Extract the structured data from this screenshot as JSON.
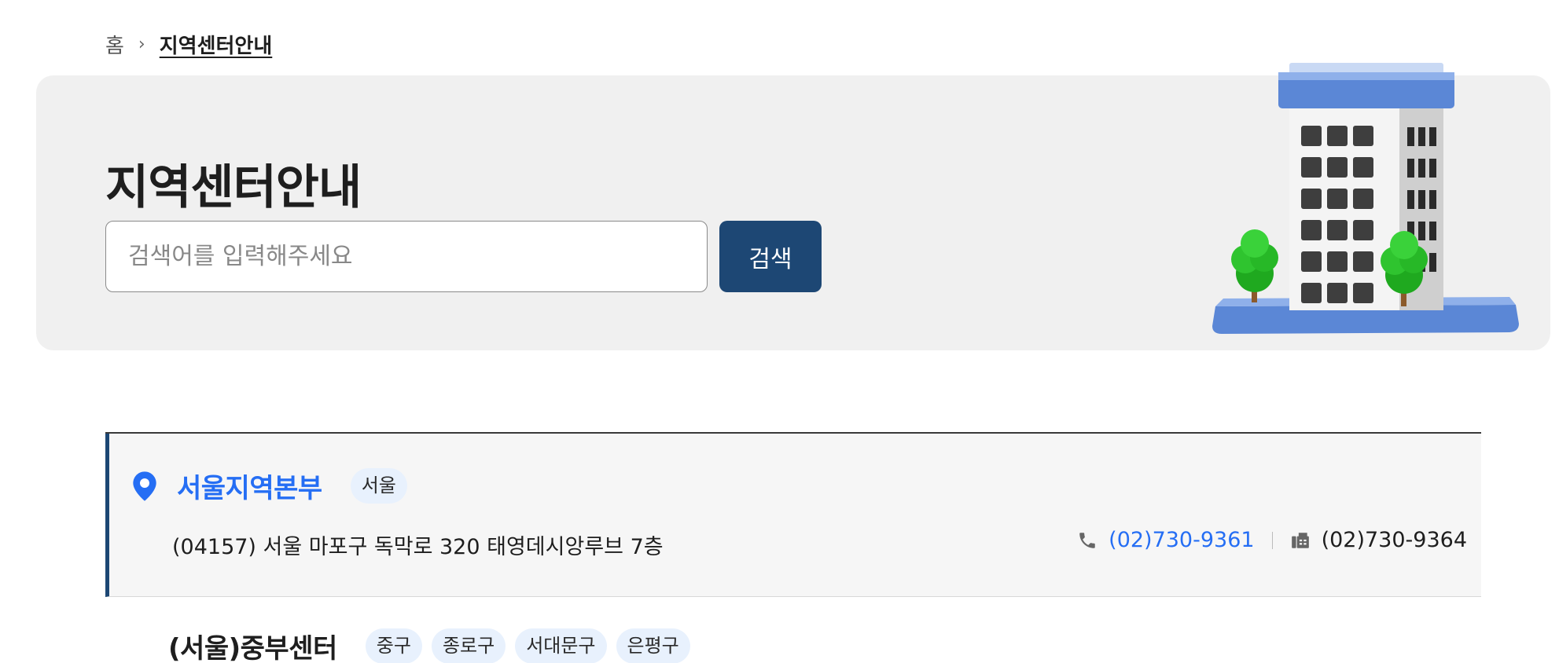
{
  "breadcrumb": {
    "home": "홈",
    "separator": "›",
    "current": "지역센터안내"
  },
  "hero": {
    "title": "지역센터안내",
    "search_placeholder": "검색어를 입력해주세요",
    "search_value": "",
    "search_button": "검색",
    "illustration": "building-icon"
  },
  "colors": {
    "primary": "#1d4774",
    "link": "#256ef4",
    "tag_bg": "#e8f1fd",
    "hero_bg": "#f0f0f0"
  },
  "centers": [
    {
      "name": "서울지역본부",
      "tags": [
        "서울"
      ],
      "address": "(04157) 서울 마포구 독막로 320 태영데시앙루브 7층",
      "phone": "(02)730-9361",
      "fax": "(02)730-9364",
      "icon": "location-pin-icon"
    },
    {
      "name": "(서울)중부센터",
      "tags": [
        "중구",
        "종로구",
        "서대문구",
        "은평구"
      ]
    }
  ]
}
